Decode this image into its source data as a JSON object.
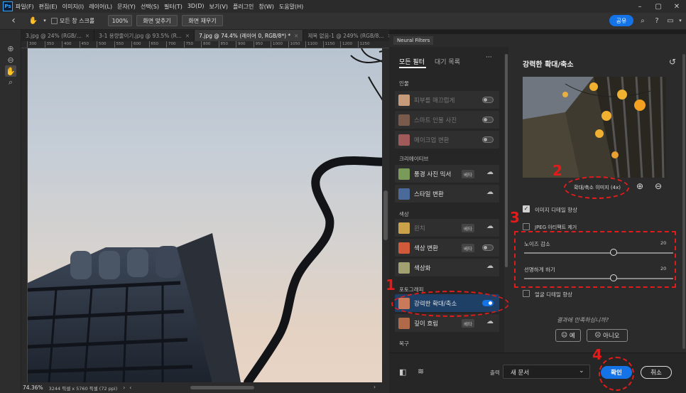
{
  "app": {
    "logo": "Ps"
  },
  "menu": [
    "파일(F)",
    "편집(E)",
    "이미지(I)",
    "레이어(L)",
    "문자(Y)",
    "선택(S)",
    "필터(T)",
    "3D(D)",
    "보기(V)",
    "플러그인",
    "창(W)",
    "도움말(H)"
  ],
  "options_bar": {
    "scroll_all_label": "모든 창 스크롤",
    "zoom_btn": "100%",
    "fit_screen_btn": "화면 맞추기",
    "fill_screen_btn": "화면 채우기",
    "share_btn": "공유"
  },
  "tabs": [
    {
      "label": "3.jpg @ 24% (RGB/...",
      "active": false
    },
    {
      "label": "3-1 용량줄이기.jpg @ 93.5% (R...",
      "active": false
    },
    {
      "label": "7.jpg @ 74.4% (레이어 0, RGB/8*) *",
      "active": true
    },
    {
      "label": "제목 없음-1 @ 249% (RGB/8...",
      "active": false
    }
  ],
  "ruler_ticks": [
    "300",
    "350",
    "400",
    "450",
    "500",
    "550",
    "600",
    "650",
    "700",
    "750",
    "800",
    "850",
    "900",
    "950",
    "1000",
    "1050",
    "1100",
    "1150",
    "1200",
    "1250"
  ],
  "status": {
    "zoom": "74.36%",
    "doc_size": "3244 픽셀 x 5760 픽셀 (72 ppi)"
  },
  "neural_filters": {
    "panel_title": "Neural Filters",
    "tab_all": "모든 필터",
    "tab_waitlist": "대기 목록",
    "more_icon": "ellipsis-icon",
    "sections": [
      {
        "title": "인물",
        "items": [
          {
            "label": "피부를 매끄럽게",
            "badge": "",
            "control": "toggle-off",
            "disabled": true,
            "color": "#c79a7a"
          },
          {
            "label": "스마트 인물 사진",
            "badge": "",
            "control": "toggle-off",
            "disabled": true,
            "color": "#7a5a4a"
          },
          {
            "label": "메이크업 변환",
            "badge": "",
            "control": "toggle-off",
            "disabled": true,
            "color": "#a05a5a"
          }
        ]
      },
      {
        "title": "크리에이티브",
        "items": [
          {
            "label": "풍경 사진 믹서",
            "badge": "베타",
            "control": "cloud",
            "disabled": false,
            "color": "#7a9a5a"
          },
          {
            "label": "스타일 변환",
            "badge": "",
            "control": "cloud",
            "disabled": false,
            "color": "#4a6a9a"
          }
        ]
      },
      {
        "title": "색상",
        "items": [
          {
            "label": "윈치",
            "badge": "베타",
            "control": "cloud",
            "disabled": true,
            "color": "#c9a24a"
          },
          {
            "label": "색상 변환",
            "badge": "베타",
            "control": "toggle-off",
            "disabled": false,
            "color": "#d05a3a"
          },
          {
            "label": "색상화",
            "badge": "",
            "control": "cloud",
            "disabled": false,
            "color": "#a0a070"
          }
        ]
      },
      {
        "title": "포토그래피",
        "items": [
          {
            "label": "강력한 확대/축소",
            "badge": "",
            "control": "toggle-on",
            "disabled": false,
            "selected": true,
            "color": "#c97a5a"
          },
          {
            "label": "깊이 흐림",
            "badge": "베타",
            "control": "cloud",
            "disabled": false,
            "color": "#b06a4a"
          }
        ]
      },
      {
        "title": "복구",
        "items": []
      }
    ]
  },
  "settings": {
    "title": "강력한 확대/축소",
    "reset_icon": "reset-icon",
    "preview_label": "확대/축소 이미지 (4x)",
    "zoom_in_icon": "zoom-in-icon",
    "zoom_out_icon": "zoom-out-icon",
    "enhance_detail": {
      "label": "이미지 디테일 향상",
      "checked": true
    },
    "jpeg_artifact": {
      "label": "JPEG 아티팩트 제거",
      "checked": false
    },
    "noise": {
      "label": "노이즈 감소",
      "value": "20",
      "fraction": 0.6
    },
    "sharpen": {
      "label": "선명하게 하기",
      "value": "20",
      "fraction": 0.6
    },
    "face_detail": {
      "label": "얼굴 디테일 향상",
      "checked": false
    },
    "feedback_question": "결과에 만족하십니까?",
    "yes": "예",
    "no": "아니오"
  },
  "footer": {
    "output_label": "출력",
    "output_value": "새 문서",
    "ok": "확인",
    "cancel": "취소"
  },
  "annotations": [
    "1",
    "2",
    "3",
    "4"
  ],
  "colors": {
    "accent": "#1473e6",
    "annotation": "#e21b1b"
  }
}
